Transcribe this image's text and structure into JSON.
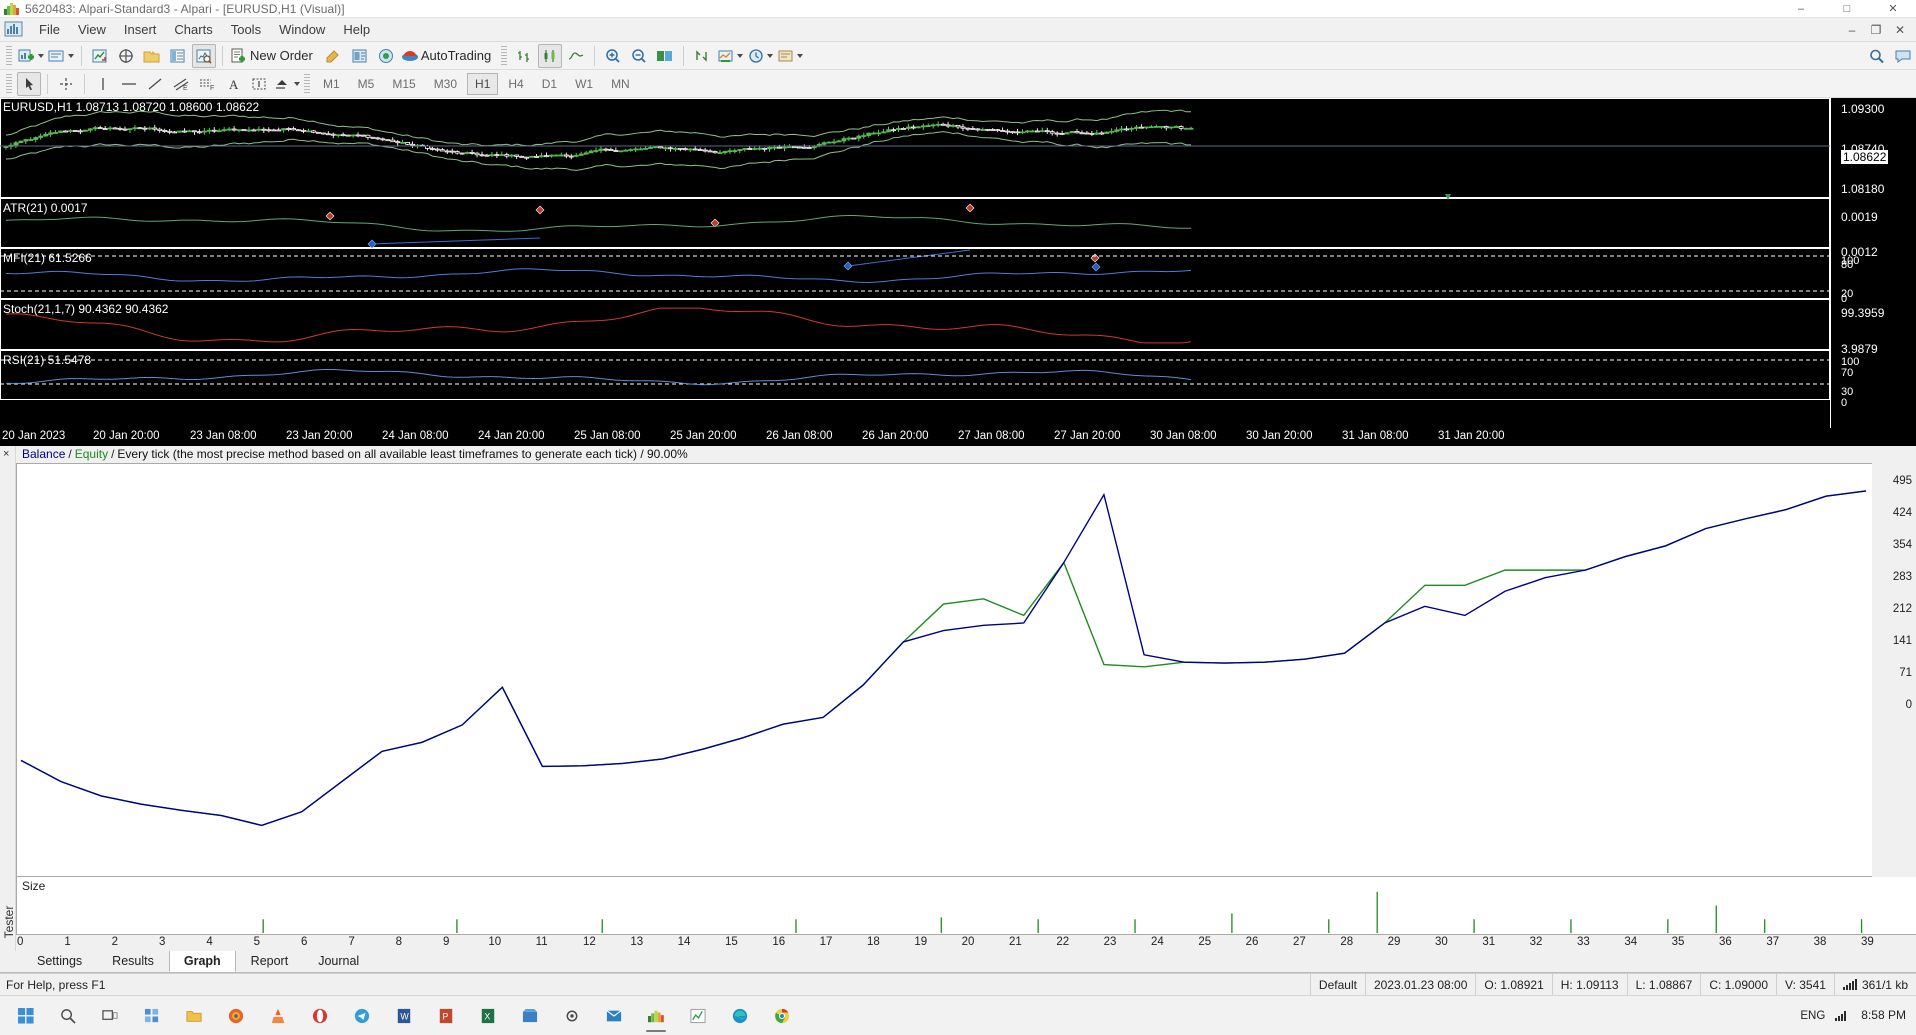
{
  "window": {
    "title": "5620483: Alpari-Standard3 - Alpari - [EURUSD,H1 (Visual)]",
    "icon": "mt4-logo-icon",
    "minimize": "–",
    "maximize": "□",
    "close": "✕",
    "inner_minimize": "–",
    "inner_restore": "❐",
    "inner_close": "✕"
  },
  "menu": {
    "items": [
      "File",
      "View",
      "Insert",
      "Charts",
      "Tools",
      "Window",
      "Help"
    ]
  },
  "toolbar_main": {
    "buttons": [
      {
        "name": "new-chart-button",
        "icon": "new-chart-icon",
        "label": "",
        "dropdown": true
      },
      {
        "name": "profiles-button",
        "icon": "profiles-icon",
        "label": "",
        "dropdown": true
      },
      {
        "name": "market-watch-button",
        "icon": "market-watch-icon",
        "label": ""
      },
      {
        "name": "navigator-button",
        "icon": "navigator-icon",
        "label": ""
      },
      {
        "name": "data-folder-button",
        "icon": "folder-icon",
        "label": ""
      },
      {
        "name": "terminal-button",
        "icon": "terminal-icon",
        "label": ""
      },
      {
        "name": "strategy-tester-button",
        "icon": "strategy-tester-icon",
        "label": "",
        "pressed": true
      },
      {
        "name": "new-order-button",
        "icon": "new-order-icon",
        "label": "New Order"
      },
      {
        "name": "metaeditor-button",
        "icon": "metaeditor-icon",
        "label": ""
      },
      {
        "name": "expert-advisors-button",
        "icon": "expert-advisors-icon",
        "label": ""
      },
      {
        "name": "autotrading-button",
        "icon": "autotrading-icon",
        "label": "AutoTrading"
      },
      {
        "name": "bar-chart-button",
        "icon": "bar-chart-icon",
        "label": ""
      },
      {
        "name": "candlestick-chart-button",
        "icon": "candlestick-icon",
        "label": "",
        "pressed": true
      },
      {
        "name": "line-chart-button",
        "icon": "line-chart-icon",
        "label": ""
      },
      {
        "name": "zoom-in-button",
        "icon": "zoom-in-icon",
        "label": ""
      },
      {
        "name": "zoom-out-button",
        "icon": "zoom-out-icon",
        "label": ""
      },
      {
        "name": "chart-shift-button",
        "icon": "chart-shift-icon",
        "label": ""
      },
      {
        "name": "auto-scroll-button",
        "icon": "auto-scroll-icon",
        "label": ""
      },
      {
        "name": "indicators-button",
        "icon": "indicators-icon",
        "label": "",
        "dropdown": true
      },
      {
        "name": "periods-button",
        "icon": "clock-icon",
        "label": "",
        "dropdown": true
      },
      {
        "name": "templates-button",
        "icon": "templates-icon",
        "label": "",
        "dropdown": true
      }
    ],
    "right_buttons": [
      {
        "name": "search-button",
        "icon": "search-icon"
      },
      {
        "name": "help-chat-button",
        "icon": "chat-icon"
      }
    ]
  },
  "toolbar_line": {
    "buttons": [
      {
        "name": "cursor-button",
        "icon": "cursor-icon",
        "pressed": true
      },
      {
        "name": "crosshair-button",
        "icon": "crosshair-icon"
      },
      {
        "name": "vertical-line-button",
        "icon": "vertical-line-icon"
      },
      {
        "name": "horizontal-line-button",
        "icon": "horizontal-line-icon"
      },
      {
        "name": "trendline-button",
        "icon": "trendline-icon"
      },
      {
        "name": "equidistant-channel-button",
        "icon": "channel-icon"
      },
      {
        "name": "fibonacci-button",
        "icon": "fibonacci-icon"
      },
      {
        "name": "text-button",
        "icon": "text-icon"
      },
      {
        "name": "text-label-button",
        "icon": "text-label-icon"
      },
      {
        "name": "arrows-button",
        "icon": "arrows-icon",
        "dropdown": true
      }
    ],
    "timeframes": [
      {
        "label": "M1",
        "active": false
      },
      {
        "label": "M5",
        "active": false
      },
      {
        "label": "M15",
        "active": false
      },
      {
        "label": "M30",
        "active": false
      },
      {
        "label": "H1",
        "active": true
      },
      {
        "label": "H4",
        "active": false
      },
      {
        "label": "D1",
        "active": false
      },
      {
        "label": "W1",
        "active": false
      },
      {
        "label": "MN",
        "active": false
      }
    ]
  },
  "chart": {
    "symbol_line": "EURUSD,H1  1.08713 1.08720 1.08600 1.08622",
    "panes": [
      {
        "name": "price-pane",
        "label": "",
        "top": 0,
        "height": 100
      },
      {
        "name": "atr-pane",
        "label": "ATR(21) 0.0017",
        "top": 100,
        "height": 50
      },
      {
        "name": "mfi-pane",
        "label": "MFI(21) 61.5266",
        "top": 150,
        "height": 51
      },
      {
        "name": "stoch-pane",
        "label": "Stoch(21,1,7) 90.4362 90.4362",
        "top": 201,
        "height": 51
      },
      {
        "name": "rsi-pane",
        "label": "RSI(21) 51.5478",
        "top": 252,
        "height": 50
      }
    ],
    "price_axis_labels": [
      {
        "text": "1.09300",
        "top": 4,
        "highlight": false
      },
      {
        "text": "1.08740",
        "top": 44,
        "highlight": false
      },
      {
        "text": "1.08622",
        "top": 52,
        "highlight": true
      },
      {
        "text": "1.08180",
        "top": 84,
        "highlight": false
      },
      {
        "text": "0.0019",
        "top": 112,
        "highlight": false
      },
      {
        "text": "0.0012",
        "top": 147,
        "highlight": false
      },
      {
        "text": "100",
        "top": 158,
        "highlight": false
      },
      {
        "text": "80",
        "top": 162,
        "highlight": false
      },
      {
        "text": "20",
        "top": 192,
        "highlight": false
      },
      {
        "text": "0",
        "top": 196,
        "highlight": false
      },
      {
        "text": "99.3959",
        "top": 210,
        "highlight": false
      },
      {
        "text": "3.9879",
        "top": 246,
        "highlight": false
      },
      {
        "text": "100",
        "top": 260,
        "highlight": false
      },
      {
        "text": "70",
        "top": 271,
        "highlight": false
      },
      {
        "text": "30",
        "top": 289,
        "highlight": false
      },
      {
        "text": "0",
        "top": 300,
        "highlight": false
      }
    ],
    "time_labels": [
      "20 Jan 2023",
      "20 Jan 20:00",
      "23 Jan 08:00",
      "23 Jan 20:00",
      "24 Jan 08:00",
      "24 Jan 20:00",
      "25 Jan 08:00",
      "25 Jan 20:00",
      "26 Jan 08:00",
      "26 Jan 20:00",
      "27 Jan 08:00",
      "27 Jan 20:00",
      "30 Jan 08:00",
      "30 Jan 20:00",
      "31 Jan 08:00",
      "31 Jan 20:00"
    ]
  },
  "tester": {
    "close_label": "×",
    "vertical_tab": "Tester",
    "header": {
      "balance": "Balance",
      "sep1": "/",
      "equity": "Equity",
      "sep2": "/",
      "rest": "Every tick (the most precise method based on all available least timeframes to generate each tick) / 90.00%"
    },
    "size_label": "Size",
    "tabs": [
      {
        "label": "Settings",
        "active": false
      },
      {
        "label": "Results",
        "active": false
      },
      {
        "label": "Graph",
        "active": true
      },
      {
        "label": "Report",
        "active": false
      },
      {
        "label": "Journal",
        "active": false
      }
    ]
  },
  "chart_data": {
    "type": "line",
    "title": "Balance / Equity",
    "xlabel": "",
    "ylabel": "",
    "ylim": [
      0,
      530
    ],
    "yticks": [
      0,
      71,
      141,
      212,
      283,
      354,
      424,
      495
    ],
    "ytick_labels": [
      "0",
      "71",
      "141",
      "212",
      "283",
      "354",
      "424",
      "495"
    ],
    "xticks": [
      0,
      1,
      2,
      3,
      4,
      5,
      6,
      7,
      8,
      9,
      10,
      11,
      12,
      13,
      14,
      15,
      16,
      17,
      18,
      19,
      20,
      21,
      22,
      23,
      24,
      25,
      26,
      27,
      28,
      29,
      30,
      31,
      32,
      33,
      34,
      35,
      36,
      37,
      38,
      39
    ],
    "legend": [
      "Balance",
      "Equity"
    ],
    "legend_position": "top-left",
    "grid": false,
    "series": [
      {
        "name": "Balance",
        "color": "#00008b",
        "values": [
          148,
          120,
          101,
          90,
          82,
          75,
          62,
          80,
          120,
          160,
          172,
          195,
          245,
          140,
          141,
          144,
          150,
          163,
          178,
          196,
          205,
          248,
          305,
          320,
          327,
          330,
          410,
          500,
          288,
          278,
          277,
          278,
          282,
          290,
          330,
          352,
          340,
          372,
          390,
          400,
          418,
          432,
          455,
          468,
          480,
          498,
          505
        ]
      },
      {
        "name": "Equity",
        "color": "#1e8c1e",
        "values": [
          148,
          120,
          101,
          90,
          82,
          75,
          62,
          80,
          120,
          160,
          172,
          195,
          245,
          140,
          141,
          144,
          150,
          163,
          178,
          196,
          205,
          248,
          305,
          355,
          362,
          340,
          410,
          275,
          272,
          278,
          277,
          278,
          282,
          290,
          330,
          380,
          380,
          400,
          400,
          400,
          418,
          432,
          455,
          468,
          480,
          498,
          505
        ]
      }
    ],
    "volume_bars": {
      "name": "Size",
      "color": "#1e8c1e",
      "x": [
        5,
        9,
        12,
        16,
        19,
        21,
        23,
        25,
        27,
        28,
        30,
        32,
        34,
        35,
        36,
        38
      ],
      "heights": [
        14,
        14,
        14,
        14,
        16,
        14,
        14,
        20,
        14,
        42,
        14,
        14,
        14,
        28,
        14,
        14
      ]
    }
  },
  "statusbar": {
    "help": "For Help, press F1",
    "profile": "Default",
    "datetime": "2023.01.23 08:00",
    "open": "O: 1.08921",
    "high": "H: 1.09113",
    "low": "L: 1.08867",
    "close": "C: 1.09000",
    "volume": "V: 3541",
    "connection": "361/1 kb"
  },
  "taskbar": {
    "items": [
      {
        "name": "start-button",
        "icon": "windows-icon"
      },
      {
        "name": "search-taskbar-button",
        "icon": "search-icon"
      },
      {
        "name": "task-view-button",
        "icon": "task-view-icon"
      },
      {
        "name": "widgets-button",
        "icon": "widgets-icon"
      },
      {
        "name": "explorer-button",
        "icon": "folder-icon"
      },
      {
        "name": "firefox-button",
        "icon": "firefox-icon"
      },
      {
        "name": "vlc-button",
        "icon": "vlc-icon"
      },
      {
        "name": "opera-button",
        "icon": "opera-icon"
      },
      {
        "name": "telegram-button",
        "icon": "telegram-icon"
      },
      {
        "name": "word-button",
        "icon": "word-icon"
      },
      {
        "name": "powerpoint-button",
        "icon": "powerpoint-icon"
      },
      {
        "name": "excel-button",
        "icon": "excel-icon"
      },
      {
        "name": "store-button",
        "icon": "store-icon"
      },
      {
        "name": "settings-button",
        "icon": "gear-icon"
      },
      {
        "name": "mail-button",
        "icon": "mail-icon"
      },
      {
        "name": "metatrader-button",
        "icon": "mt4-logo-icon",
        "active": true
      },
      {
        "name": "chart-app-button",
        "icon": "chart-icon"
      },
      {
        "name": "edge-button",
        "icon": "edge-icon"
      },
      {
        "name": "chrome-button",
        "icon": "chrome-icon"
      }
    ],
    "tray": {
      "lang": "ENG",
      "time": "8:58 PM",
      "date": ""
    }
  }
}
